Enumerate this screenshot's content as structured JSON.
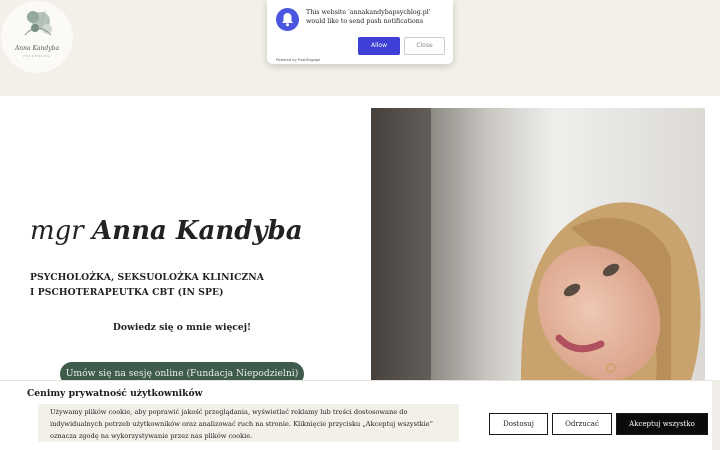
{
  "logo": {
    "name": "Anna Kandyba",
    "tagline": "PSYCHOLOG"
  },
  "push": {
    "message": "This website 'annakandybapsychlog.pl' would like to send push notifications",
    "allow_label": "Allow",
    "close_label": "Close",
    "powered_by": "Powered by PushEngage",
    "accent": "#3d3fd6"
  },
  "hero": {
    "title_prefix": "mgr",
    "title_name": "Anna Kandyba",
    "subtitle": "PSYCHOLOŻKA, SEKSUOLOŻKA KLINICZNA I PSCHOTERAPEUTKA CBT (IN SPE)",
    "more_link": "Dowiedz się o mnie więcej!",
    "cta_label": "Umów się na sesję online (Fundacja Niepodzielni)",
    "cta_color": "#3f5b4b"
  },
  "cookie": {
    "title": "Cenimy prywatność użytkowników",
    "text": "Używamy plików cookie, aby poprawić jakość przeglądania, wyświetlać reklamy lub treści dostosowane do indywidualnych potrzeb użytkowników oraz analizować ruch na stronie. Kliknięcie przycisku „Akceptuj wszystkie” oznacza zgodę na wykorzystywanie przez nas plików cookie.",
    "customize_label": "Dostosuj",
    "reject_label": "Odrzucać",
    "accept_label": "Akceptuj wszystko"
  }
}
